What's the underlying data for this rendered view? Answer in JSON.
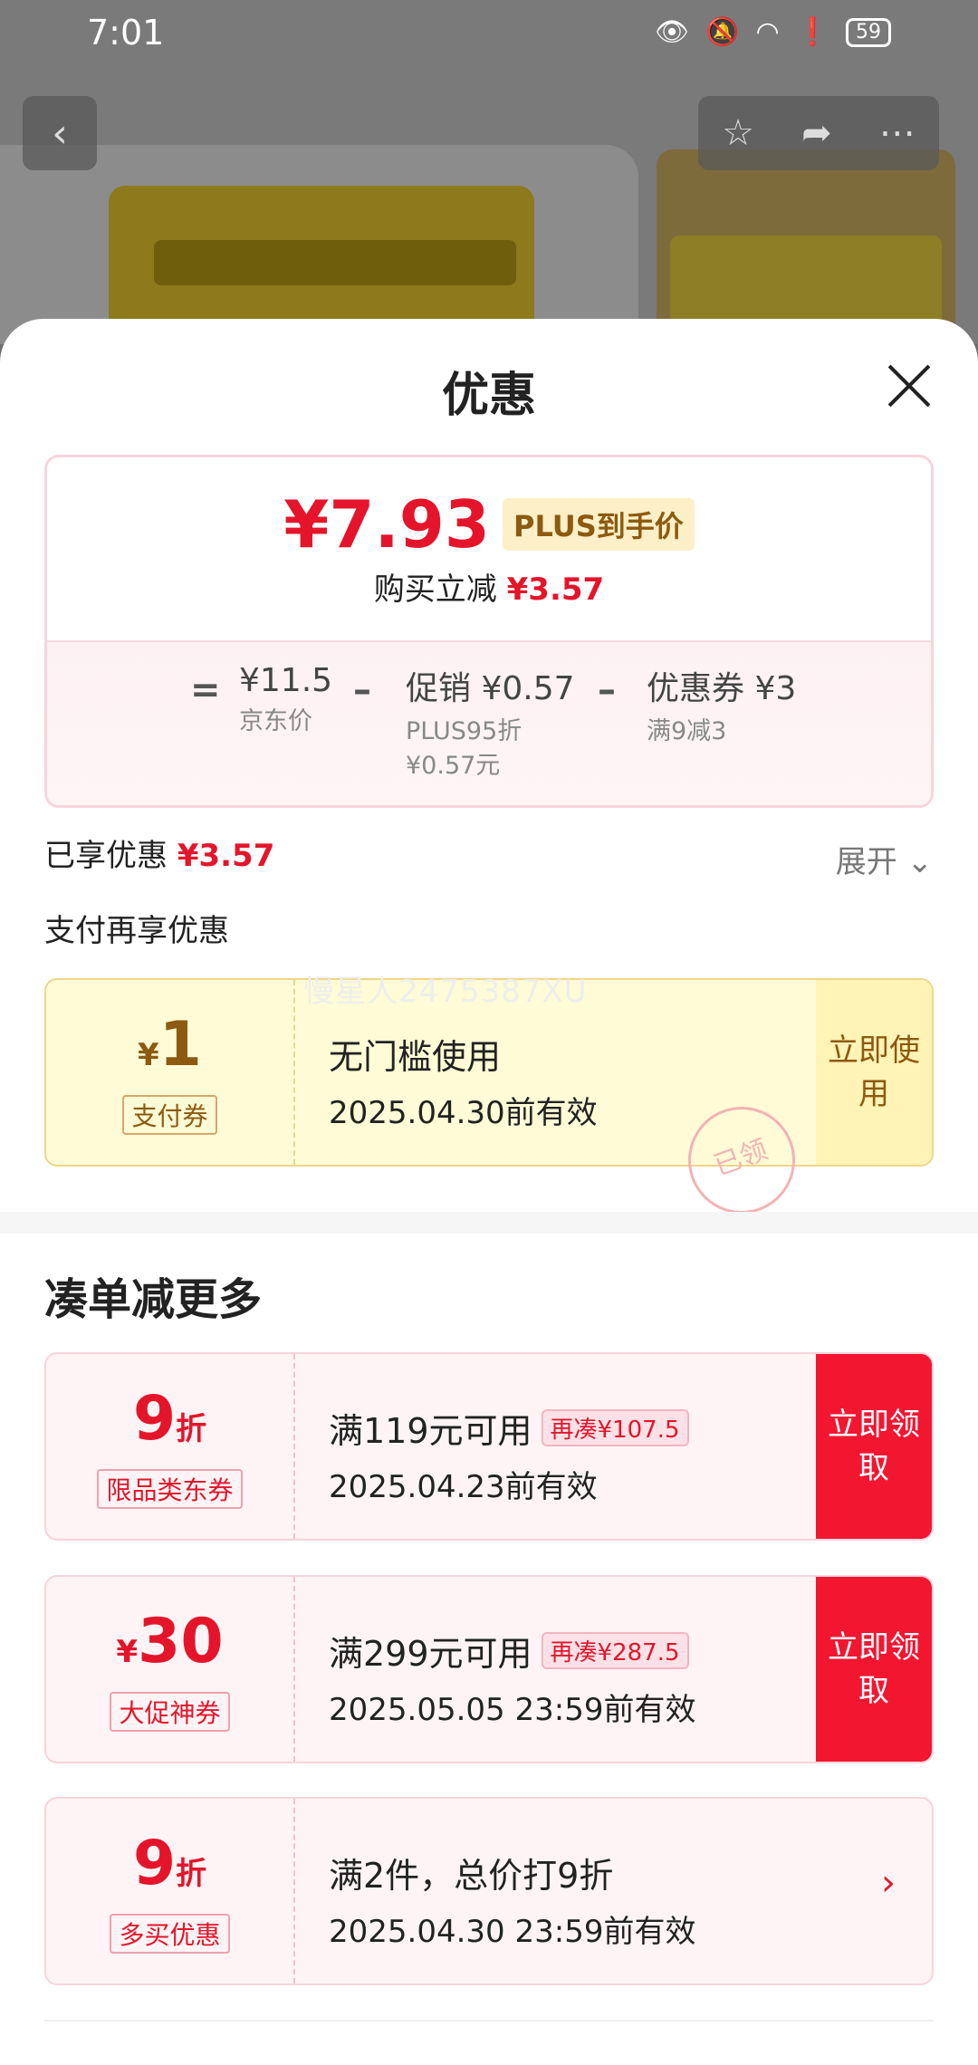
{
  "status_bar": {
    "time": "7:01",
    "battery": "59"
  },
  "sheet": {
    "title": "优惠",
    "price": {
      "final_price": "¥7.93",
      "plus_tag": "PLUS到手价",
      "reduce_label": "购买立减",
      "reduce_value": "¥3.57",
      "equals": "=",
      "minus": "–",
      "jd_price_value": "¥11.5",
      "jd_price_label": "京东价",
      "promo_title": "促销 ¥0.57",
      "promo_line1": "PLUS95折",
      "promo_line2": "¥0.57元",
      "coupon_title": "优惠券 ¥3",
      "coupon_line1": "满9减3"
    },
    "enjoyed_label": "已享优惠",
    "enjoyed_value": "¥3.57",
    "expand_label": "展开 ⌄",
    "pay_more_label": "支付再享优惠",
    "watermark": "慢星人2475387XU",
    "pay_coupon": {
      "symbol": "¥",
      "amount": "1",
      "label": "支付券",
      "condition": "无门槛使用",
      "date": "2025.04.30前有效",
      "action": "立即使用",
      "stamp": "已领"
    },
    "section_title": "凑单减更多",
    "coupons": [
      {
        "amount": "9",
        "unit": "折",
        "label": "限品类东券",
        "condition": "满119元可用",
        "extra": "再凑¥107.5",
        "date": "2025.04.23前有效",
        "action": "立即领取"
      },
      {
        "symbol": "¥",
        "amount": "30",
        "label": "大促神券",
        "condition": "满299元可用",
        "extra": "再凑¥287.5",
        "date": "2025.05.05 23:59前有效",
        "action": "立即领取"
      },
      {
        "amount": "9",
        "unit": "折",
        "label": "多买优惠",
        "condition": "满2件，总价打9折",
        "date": "2025.04.30 23:59前有效"
      }
    ]
  },
  "colors": {
    "accent_red": "#e4152b",
    "button_red": "#f31631",
    "gold": "#8c5a10"
  }
}
